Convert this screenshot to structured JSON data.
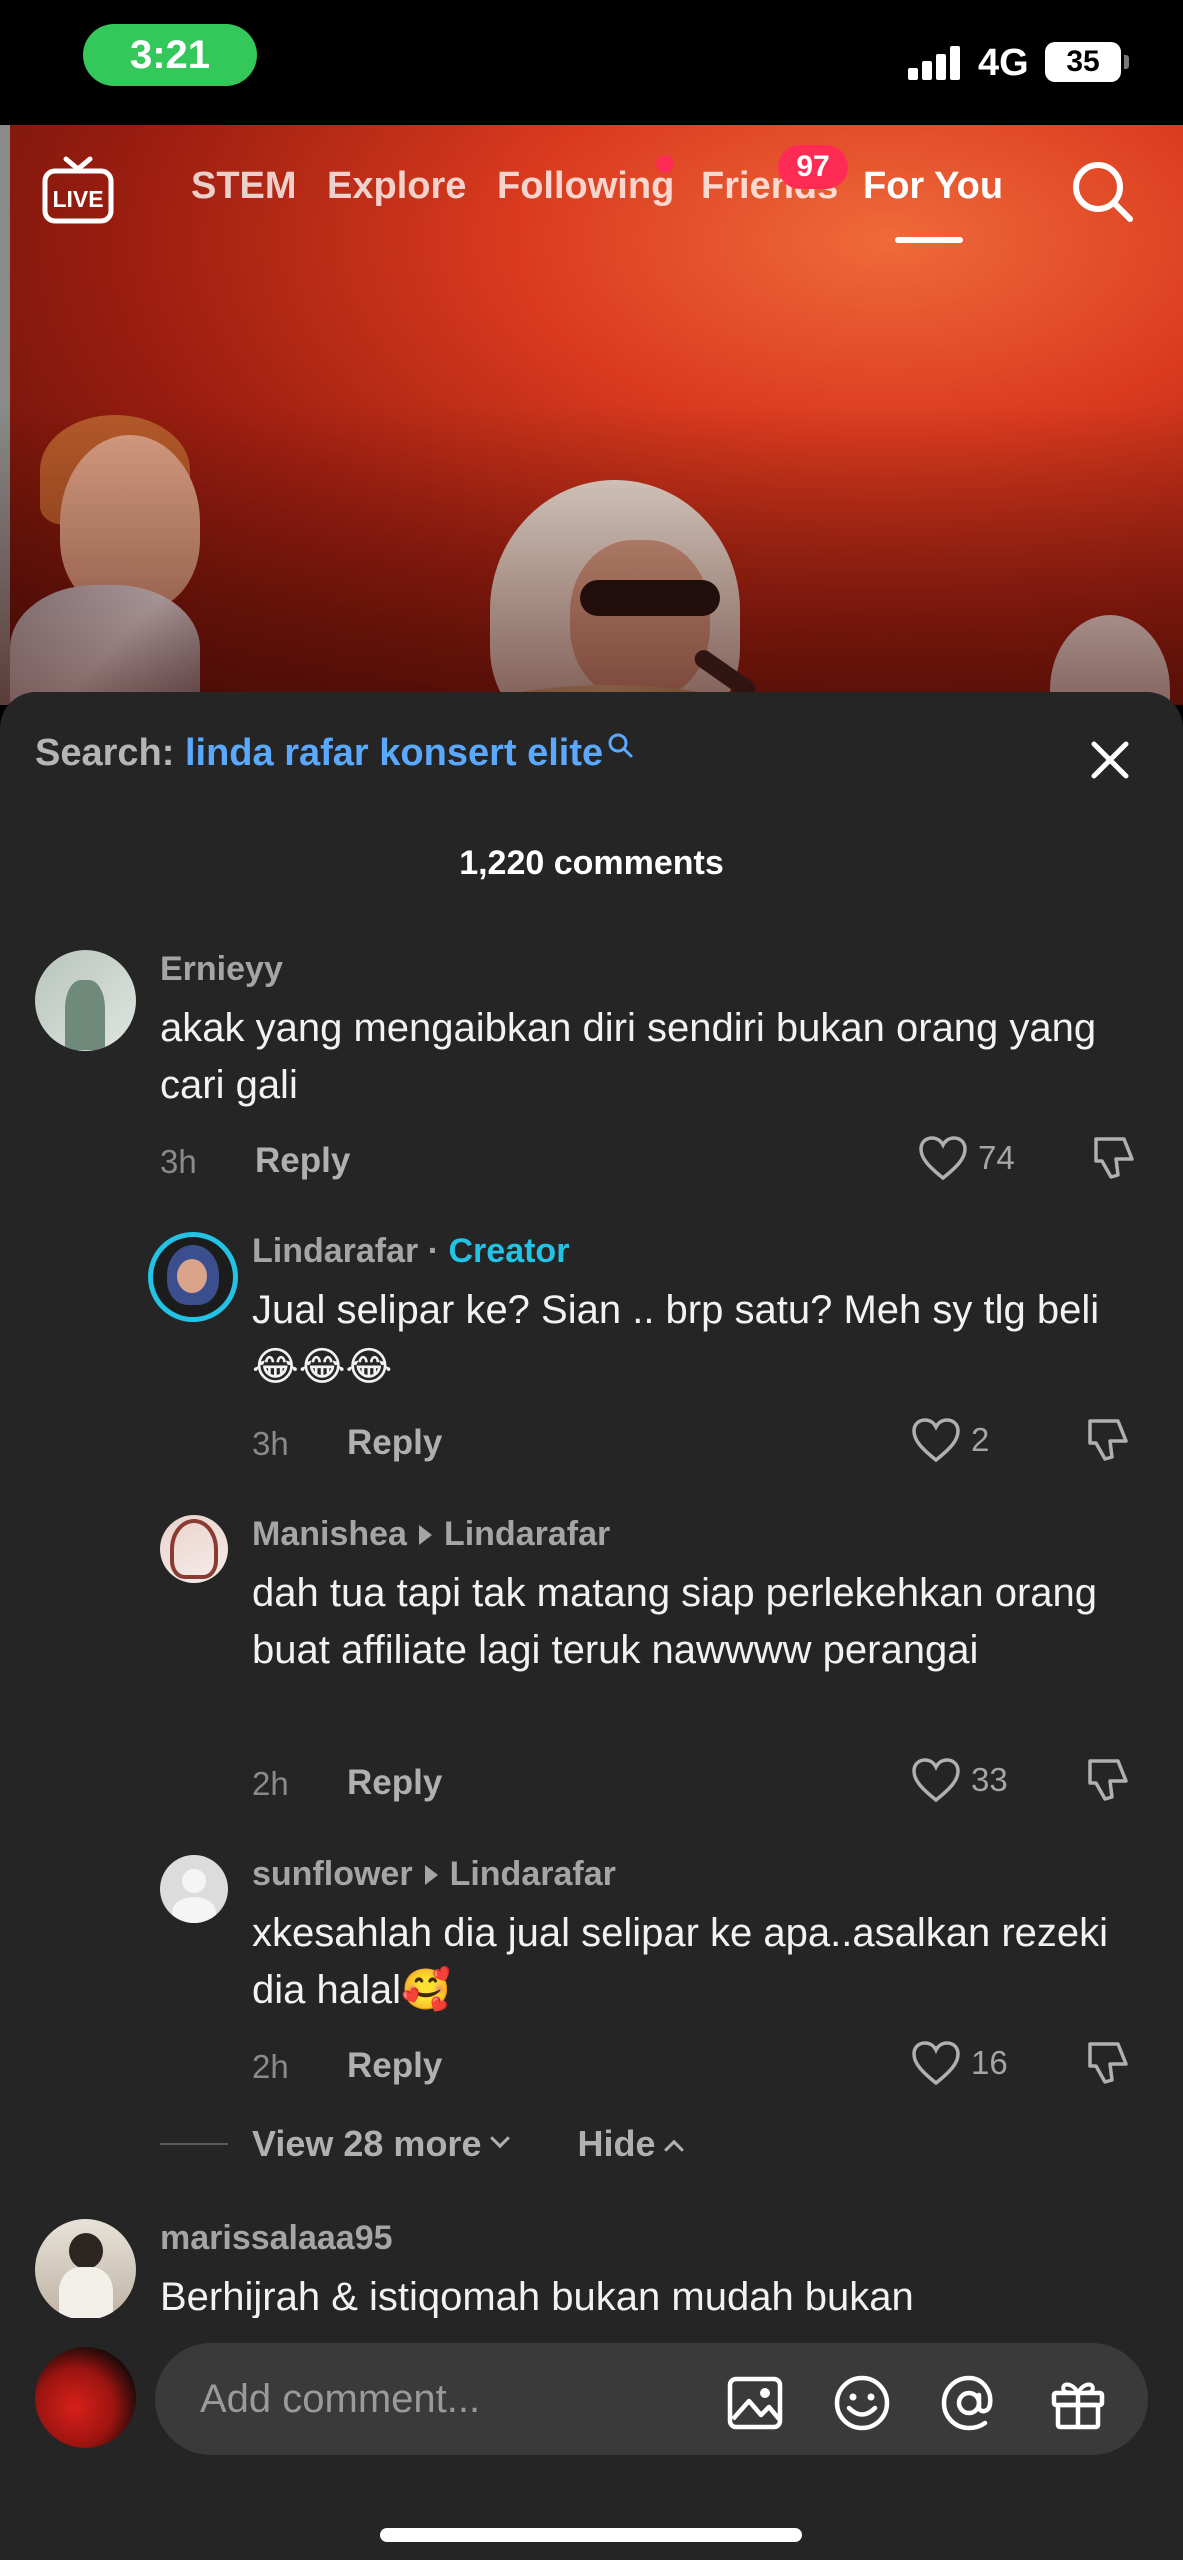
{
  "status_bar": {
    "time": "3:21",
    "network": "4G",
    "battery": "35"
  },
  "topnav": {
    "tabs": [
      {
        "label": "STEM"
      },
      {
        "label": "Explore"
      },
      {
        "label": "Following"
      },
      {
        "label": "Friends",
        "badge": "97"
      },
      {
        "label": "For You",
        "active": true
      }
    ],
    "icons": [
      "live-icon",
      "search-icon"
    ]
  },
  "sheet": {
    "search_prefix": "Search:",
    "search_query": "linda rafar konsert elite",
    "comment_count": "1,220 comments",
    "comments": [
      {
        "user": "Ernieyy",
        "text": "akak yang mengaibkan diri sendiri bukan orang yang cari gali",
        "time": "3h",
        "reply": "Reply",
        "likes": "74"
      },
      {
        "user": "Lindarafar",
        "separator": "·",
        "tag": "Creator",
        "text": "Jual selipar ke? Sian .. brp satu? Meh sy tlg beli 😂😂😂",
        "time": "3h",
        "reply": "Reply",
        "likes": "2"
      },
      {
        "user": "Manishea",
        "reply_to": "Lindarafar",
        "text": "dah tua tapi tak matang siap perlekehkan orang buat affiliate lagi teruk nawwww perangai",
        "time": "2h",
        "reply": "Reply",
        "likes": "33"
      },
      {
        "user": "sunflower",
        "reply_to": "Lindarafar",
        "text": "xkesahlah dia jual selipar ke apa..asalkan rezeki dia halal🥰",
        "time": "2h",
        "reply": "Reply",
        "likes": "16"
      },
      {
        "user": "marissalaaa95",
        "text": "Berhijrah & istiqomah bukan mudah bukan"
      }
    ],
    "view_more": "View 28 more",
    "hide": "Hide"
  },
  "bottom": {
    "placeholder": "Add comment...",
    "icons": [
      "image-icon",
      "emoji-icon",
      "mention-icon",
      "gift-icon"
    ]
  },
  "colors": {
    "accent_pink": "#fe2c55",
    "link_blue": "#5aa9ff",
    "creator_cyan": "#23c3e6",
    "time_green": "#34c759"
  }
}
